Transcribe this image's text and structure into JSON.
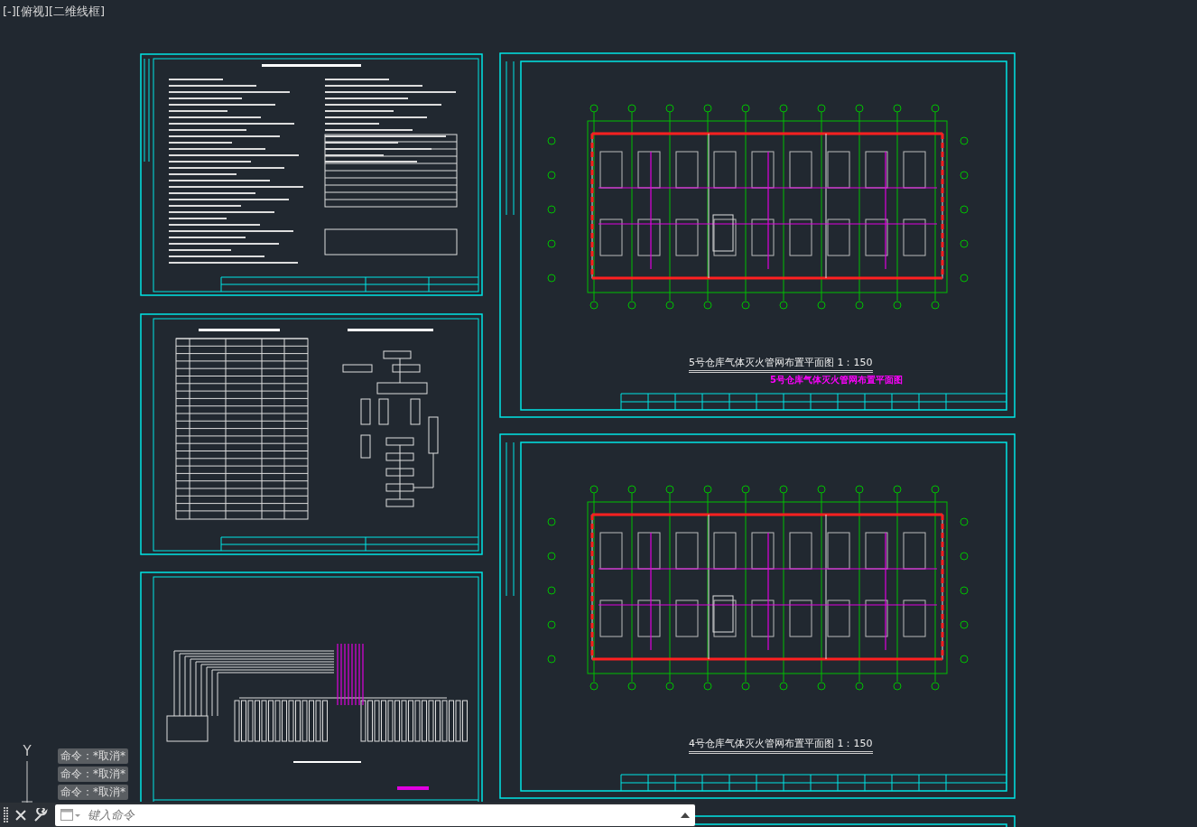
{
  "viewport_label": "[-][俯视][二维线框]",
  "sheets": [
    {
      "kind": "notes"
    },
    {
      "kind": "table"
    },
    {
      "kind": "system"
    },
    {
      "kind": "plan",
      "title": "5号仓库气体灭火管网布置平面图 1：150",
      "caption": "5号仓库气体灭火管网布置平面图"
    },
    {
      "kind": "plan",
      "title": "4号仓库气体灭火管网布置平面图 1：150"
    },
    {
      "kind": "blank"
    }
  ],
  "ucs_axis": "Y",
  "command_history": [
    "命令：*取消*",
    "命令：*取消*",
    "命令：*取消*"
  ],
  "command_line": {
    "placeholder": "键入命令"
  }
}
